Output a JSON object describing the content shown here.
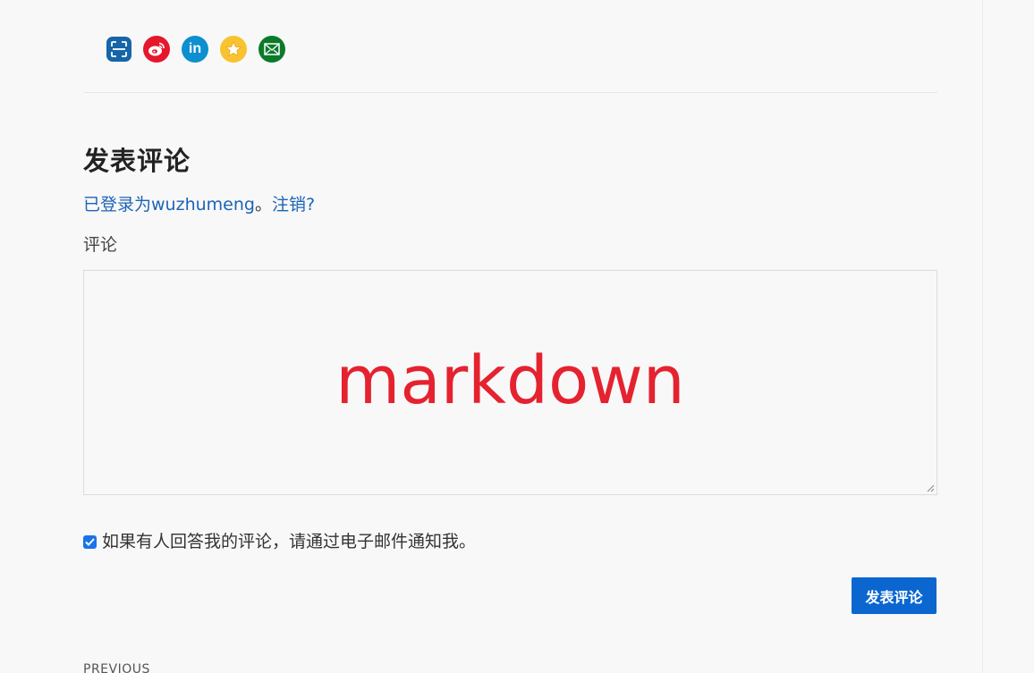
{
  "share": {
    "icons": [
      "qr-scan-icon",
      "weibo-icon",
      "linkedin-icon",
      "star-icon",
      "mail-icon"
    ],
    "colors": {
      "qr": "#1565a8",
      "weibo": "#e6162d",
      "linkedin": "#0d8fd0",
      "star": "#f8c32f",
      "mail": "#0b7a2a"
    },
    "linkedin_text": "in"
  },
  "comment_form": {
    "heading": "发表评论",
    "logged_in_prefix": "已登录为",
    "username": "wuzhumeng",
    "separator": "。",
    "logout_label": "注销?",
    "comment_label": "评论",
    "comment_value": "markdown",
    "notify_checked": true,
    "notify_label": "如果有人回答我的评论，请通过电子邮件通知我。",
    "submit_label": "发表评论"
  },
  "nav": {
    "previous_label": "PREVIOUS"
  },
  "theme": {
    "link": "#1b64b6",
    "button": "#0b66d0",
    "comment_text": "#e5222f"
  }
}
